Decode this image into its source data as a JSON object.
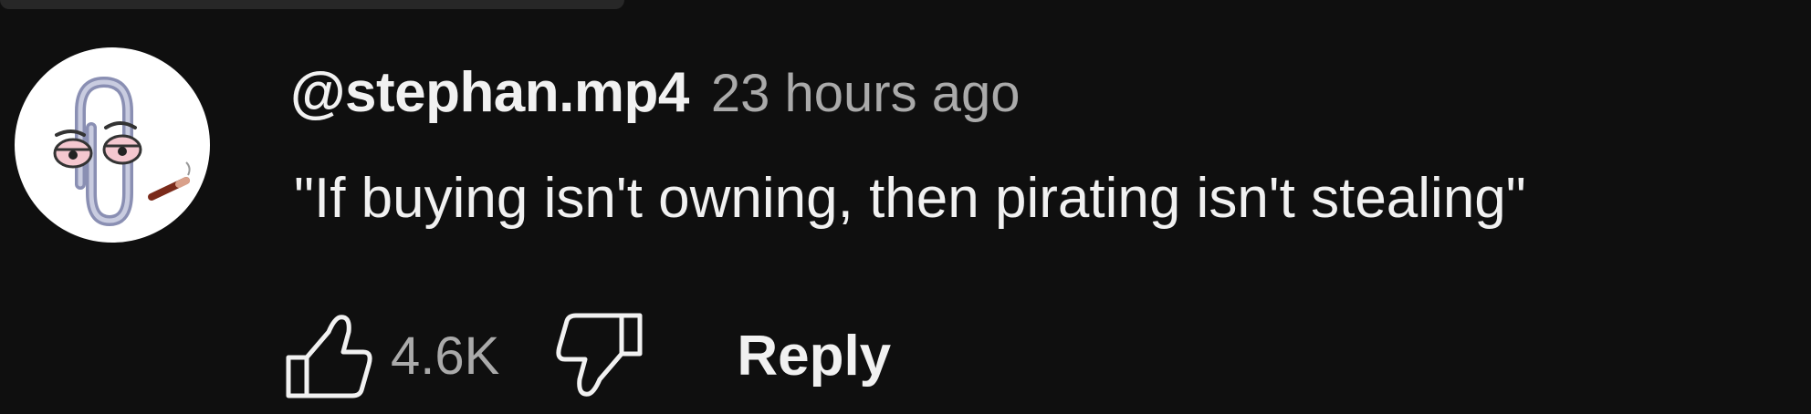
{
  "comment": {
    "author": "@stephan.mp4",
    "timestamp": "23 hours ago",
    "text": "\"If buying isn't owning, then pirating isn't stealing\"",
    "like_count": "4.6K",
    "reply_label": "Reply",
    "avatar_icon": "clippy-avatar"
  },
  "colors": {
    "background": "#0f0f0f",
    "primary_text": "#f1f1f1",
    "secondary_text": "#aaaaaa"
  },
  "icons": {
    "like": "thumbs-up-icon",
    "dislike": "thumbs-down-icon"
  }
}
